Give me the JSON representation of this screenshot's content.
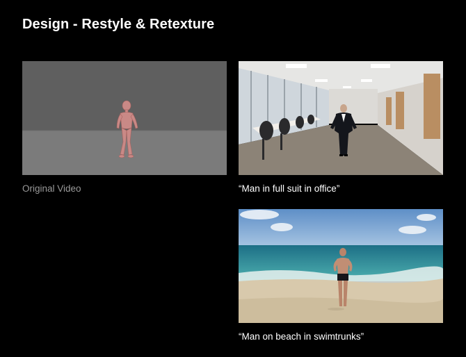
{
  "page": {
    "title": "Design - Restyle & Retexture"
  },
  "items": [
    {
      "caption": "Original Video",
      "image": "mannequin-render-gray-room"
    },
    {
      "caption": "“Man in full suit in office”",
      "image": "man-suit-office"
    },
    {
      "caption": "“Man on beach in swimtrunks”",
      "image": "man-beach-swimtrunks"
    }
  ],
  "colors": {
    "background": "#000000",
    "caption_primary": "#ffffff",
    "caption_muted": "#9a9a9a"
  }
}
